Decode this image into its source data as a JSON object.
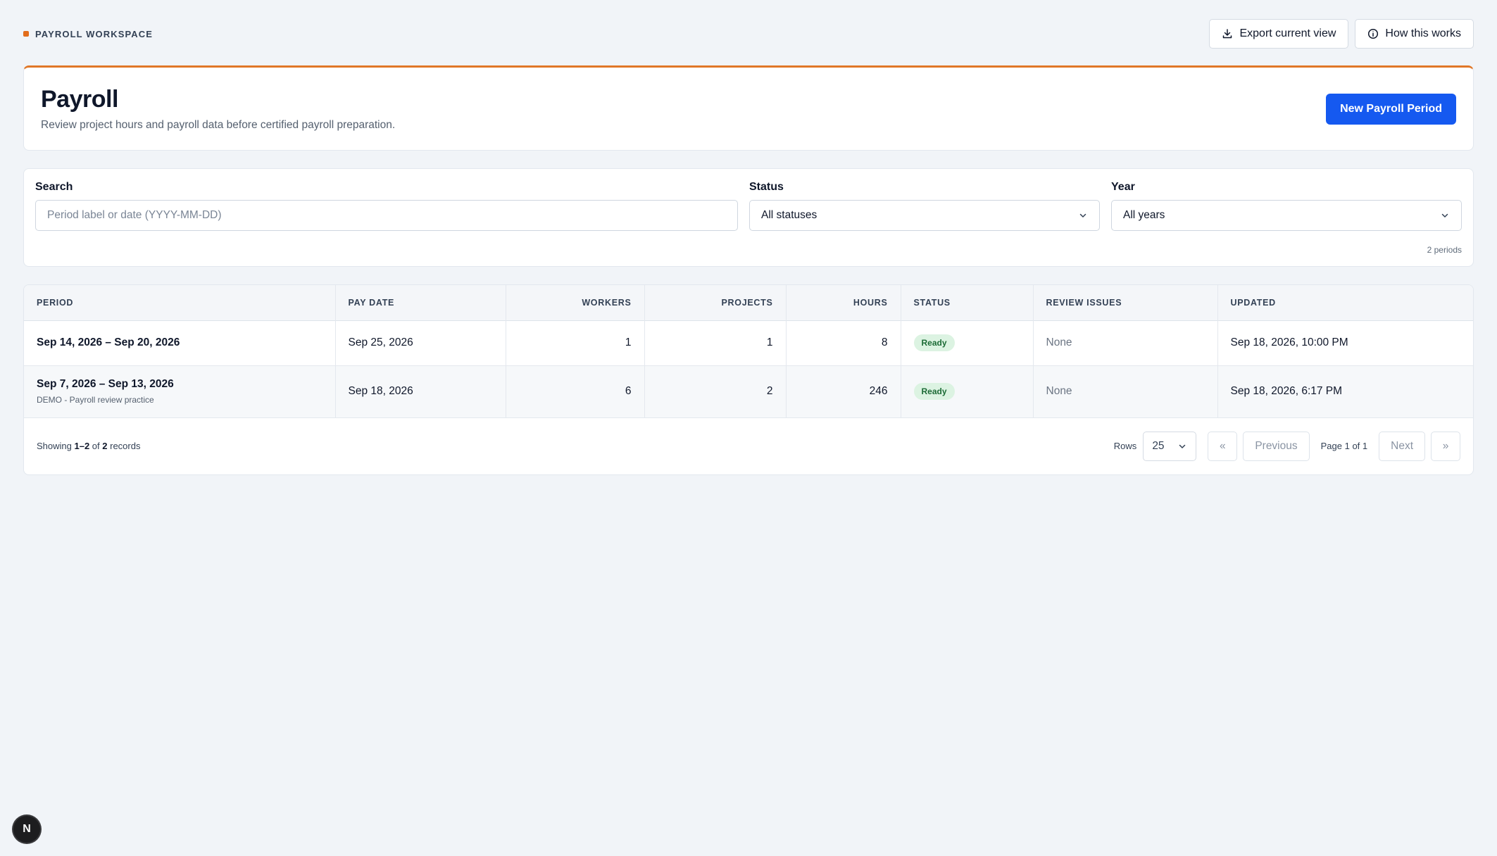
{
  "topbar": {
    "workspace_label": "PAYROLL WORKSPACE",
    "export_label": "Export current view",
    "how_label": "How this works"
  },
  "header": {
    "title": "Payroll",
    "subtitle": "Review project hours and payroll data before certified payroll preparation.",
    "new_period_label": "New Payroll Period"
  },
  "filters": {
    "search_label": "Search",
    "search_placeholder": "Period label or date (YYYY-MM-DD)",
    "status_label": "Status",
    "status_value": "All statuses",
    "year_label": "Year",
    "year_value": "All years",
    "count_note": "2 periods"
  },
  "table": {
    "columns": [
      "PERIOD",
      "PAY DATE",
      "WORKERS",
      "PROJECTS",
      "HOURS",
      "STATUS",
      "REVIEW ISSUES",
      "UPDATED"
    ],
    "rows": [
      {
        "period": "Sep 14, 2026 – Sep 20, 2026",
        "period_note": "",
        "pay_date": "Sep 25, 2026",
        "workers": "1",
        "projects": "1",
        "hours": "8",
        "status": "Ready",
        "review_issues": "None",
        "updated": "Sep 18, 2026, 10:00 PM"
      },
      {
        "period": "Sep 7, 2026 – Sep 13, 2026",
        "period_note": "DEMO - Payroll review practice",
        "pay_date": "Sep 18, 2026",
        "workers": "6",
        "projects": "2",
        "hours": "246",
        "status": "Ready",
        "review_issues": "None",
        "updated": "Sep 18, 2026, 6:17 PM"
      }
    ]
  },
  "footer": {
    "showing_prefix": "Showing ",
    "showing_range": "1–2",
    "showing_mid": " of ",
    "showing_total": "2",
    "showing_suffix": " records",
    "rows_label": "Rows",
    "rows_value": "25",
    "first_label": "«",
    "prev_label": "Previous",
    "page_info": "Page 1 of 1",
    "next_label": "Next",
    "last_label": "»"
  },
  "dev_badge": "N",
  "colors": {
    "accent_orange": "#e07728",
    "primary_blue": "#1559f0",
    "ready_bg": "#dcf3e2",
    "ready_text": "#1c6b36"
  }
}
